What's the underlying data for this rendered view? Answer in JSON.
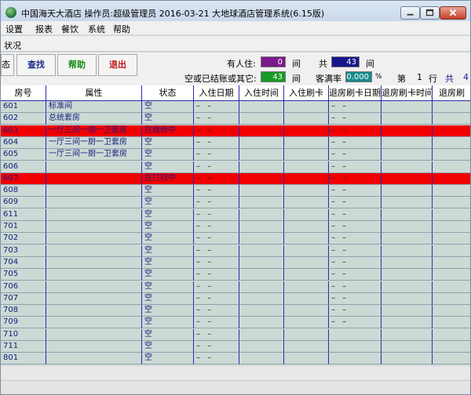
{
  "window": {
    "title": "中国海天大酒店     操作员:超级管理员     2016-03-21     大地球酒店管理系统(6.15版)"
  },
  "menu": [
    "设置",
    "报表",
    "餐饮",
    "系统",
    "帮助"
  ],
  "section_title": "状况",
  "toolbar": {
    "partial_label": "态",
    "search_label": "查找",
    "help_label": "帮助",
    "exit_label": "退出"
  },
  "stats": {
    "occupied_label": "有人住:",
    "occupied_value": "0",
    "occupied_unit": "间",
    "total_label": "共",
    "total_value": "43",
    "total_unit": "间",
    "empty_label": "空或已结账或其它:",
    "empty_value": "43",
    "empty_unit": "间",
    "rate_label": "客满率",
    "rate_value": "0.000",
    "rate_unit": "%",
    "page_label": "第",
    "page_value": "1",
    "page_unit": "行",
    "page_total_label": "共",
    "page_total_tail": "4"
  },
  "colors": {
    "occupied": "#7a1a8a",
    "total": "#17178c",
    "empty": "#159a25",
    "rate": "#158a8a",
    "row_highlight": "#f00000"
  },
  "table": {
    "columns": [
      "房号",
      "属性",
      "状态",
      "入住日期",
      "入住时间",
      "入住刷卡",
      "退房刷卡日期",
      "退房刷卡时间",
      "退房刷"
    ],
    "rows": [
      {
        "room": "601",
        "type": "标准间",
        "status": "空",
        "highlight": false,
        "dash_cols": [
          3,
          6
        ]
      },
      {
        "room": "602",
        "type": "总统套房",
        "status": "空",
        "highlight": false,
        "dash_cols": [
          3,
          6
        ]
      },
      {
        "room": "603",
        "type": "一厅三间一厨一卫套房",
        "status": "在维修中",
        "highlight": true,
        "dash_cols": [
          3,
          6
        ]
      },
      {
        "room": "604",
        "type": "一厅三间一厨一卫套房",
        "status": "空",
        "highlight": false,
        "dash_cols": [
          3,
          6
        ]
      },
      {
        "room": "605",
        "type": "一厅三间一厨一卫套房",
        "status": "空",
        "highlight": false,
        "dash_cols": [
          3,
          6
        ]
      },
      {
        "room": "606",
        "type": "",
        "status": "空",
        "highlight": false,
        "dash_cols": [
          3,
          6
        ]
      },
      {
        "room": "607",
        "type": "",
        "status": "在打扫中",
        "highlight": true,
        "dash_cols": [
          3,
          6
        ]
      },
      {
        "room": "608",
        "type": "",
        "status": "空",
        "highlight": false,
        "dash_cols": [
          3,
          6
        ]
      },
      {
        "room": "609",
        "type": "",
        "status": "空",
        "highlight": false,
        "dash_cols": [
          3,
          6
        ]
      },
      {
        "room": "611",
        "type": "",
        "status": "空",
        "highlight": false,
        "dash_cols": [
          3,
          6
        ]
      },
      {
        "room": "701",
        "type": "",
        "status": "空",
        "highlight": false,
        "dash_cols": [
          3,
          6
        ]
      },
      {
        "room": "702",
        "type": "",
        "status": "空",
        "highlight": false,
        "dash_cols": [
          3,
          6
        ]
      },
      {
        "room": "703",
        "type": "",
        "status": "空",
        "highlight": false,
        "dash_cols": [
          3,
          6
        ]
      },
      {
        "room": "704",
        "type": "",
        "status": "空",
        "highlight": false,
        "dash_cols": [
          3,
          6
        ]
      },
      {
        "room": "705",
        "type": "",
        "status": "空",
        "highlight": false,
        "dash_cols": [
          3,
          6
        ]
      },
      {
        "room": "706",
        "type": "",
        "status": "空",
        "highlight": false,
        "dash_cols": [
          3,
          6
        ]
      },
      {
        "room": "707",
        "type": "",
        "status": "空",
        "highlight": false,
        "dash_cols": [
          3,
          6
        ]
      },
      {
        "room": "708",
        "type": "",
        "status": "空",
        "highlight": false,
        "dash_cols": [
          3,
          6
        ]
      },
      {
        "room": "709",
        "type": "",
        "status": "空",
        "highlight": false,
        "dash_cols": [
          3,
          6
        ]
      },
      {
        "room": "710",
        "type": "",
        "status": "空",
        "highlight": false,
        "dash_cols": [
          3
        ]
      },
      {
        "room": "711",
        "type": "",
        "status": "空",
        "highlight": false,
        "dash_cols": [
          3
        ]
      },
      {
        "room": "801",
        "type": "",
        "status": "空",
        "highlight": false,
        "dash_cols": [
          3
        ]
      }
    ],
    "dash_text": "– –"
  }
}
